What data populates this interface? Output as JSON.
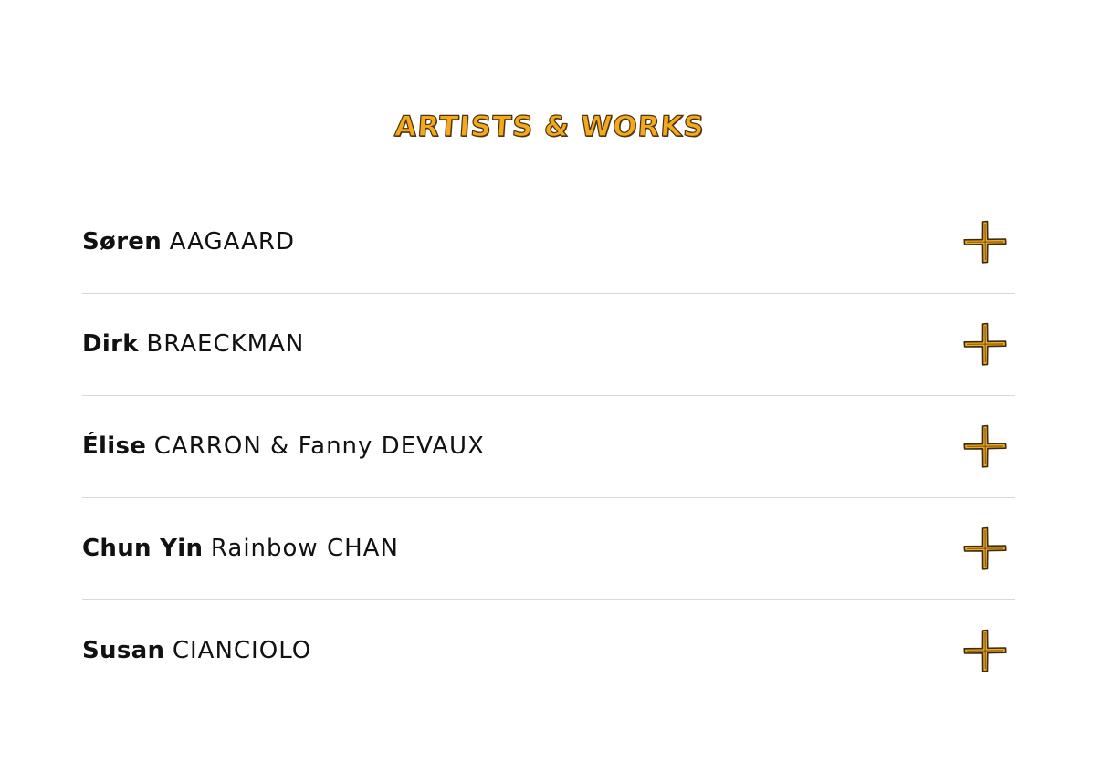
{
  "section": {
    "title": "ARTISTS & WORKS"
  },
  "colors": {
    "accent": "#F3A81E",
    "outline": "#3a2a10",
    "divider": "#d9d9d9",
    "text": "#111111"
  },
  "artists": [
    {
      "first": "Søren",
      "last": "AAGAARD",
      "toggle_icon": "plus-icon"
    },
    {
      "first": "Dirk",
      "last": "BRAECKMAN",
      "toggle_icon": "plus-icon"
    },
    {
      "first": "Élise",
      "last": "CARRON & Fanny DEVAUX",
      "toggle_icon": "plus-icon"
    },
    {
      "first": "Chun Yin",
      "last": "Rainbow CHAN",
      "toggle_icon": "plus-icon"
    },
    {
      "first": "Susan",
      "last": "CIANCIOLO",
      "toggle_icon": "plus-icon"
    }
  ]
}
